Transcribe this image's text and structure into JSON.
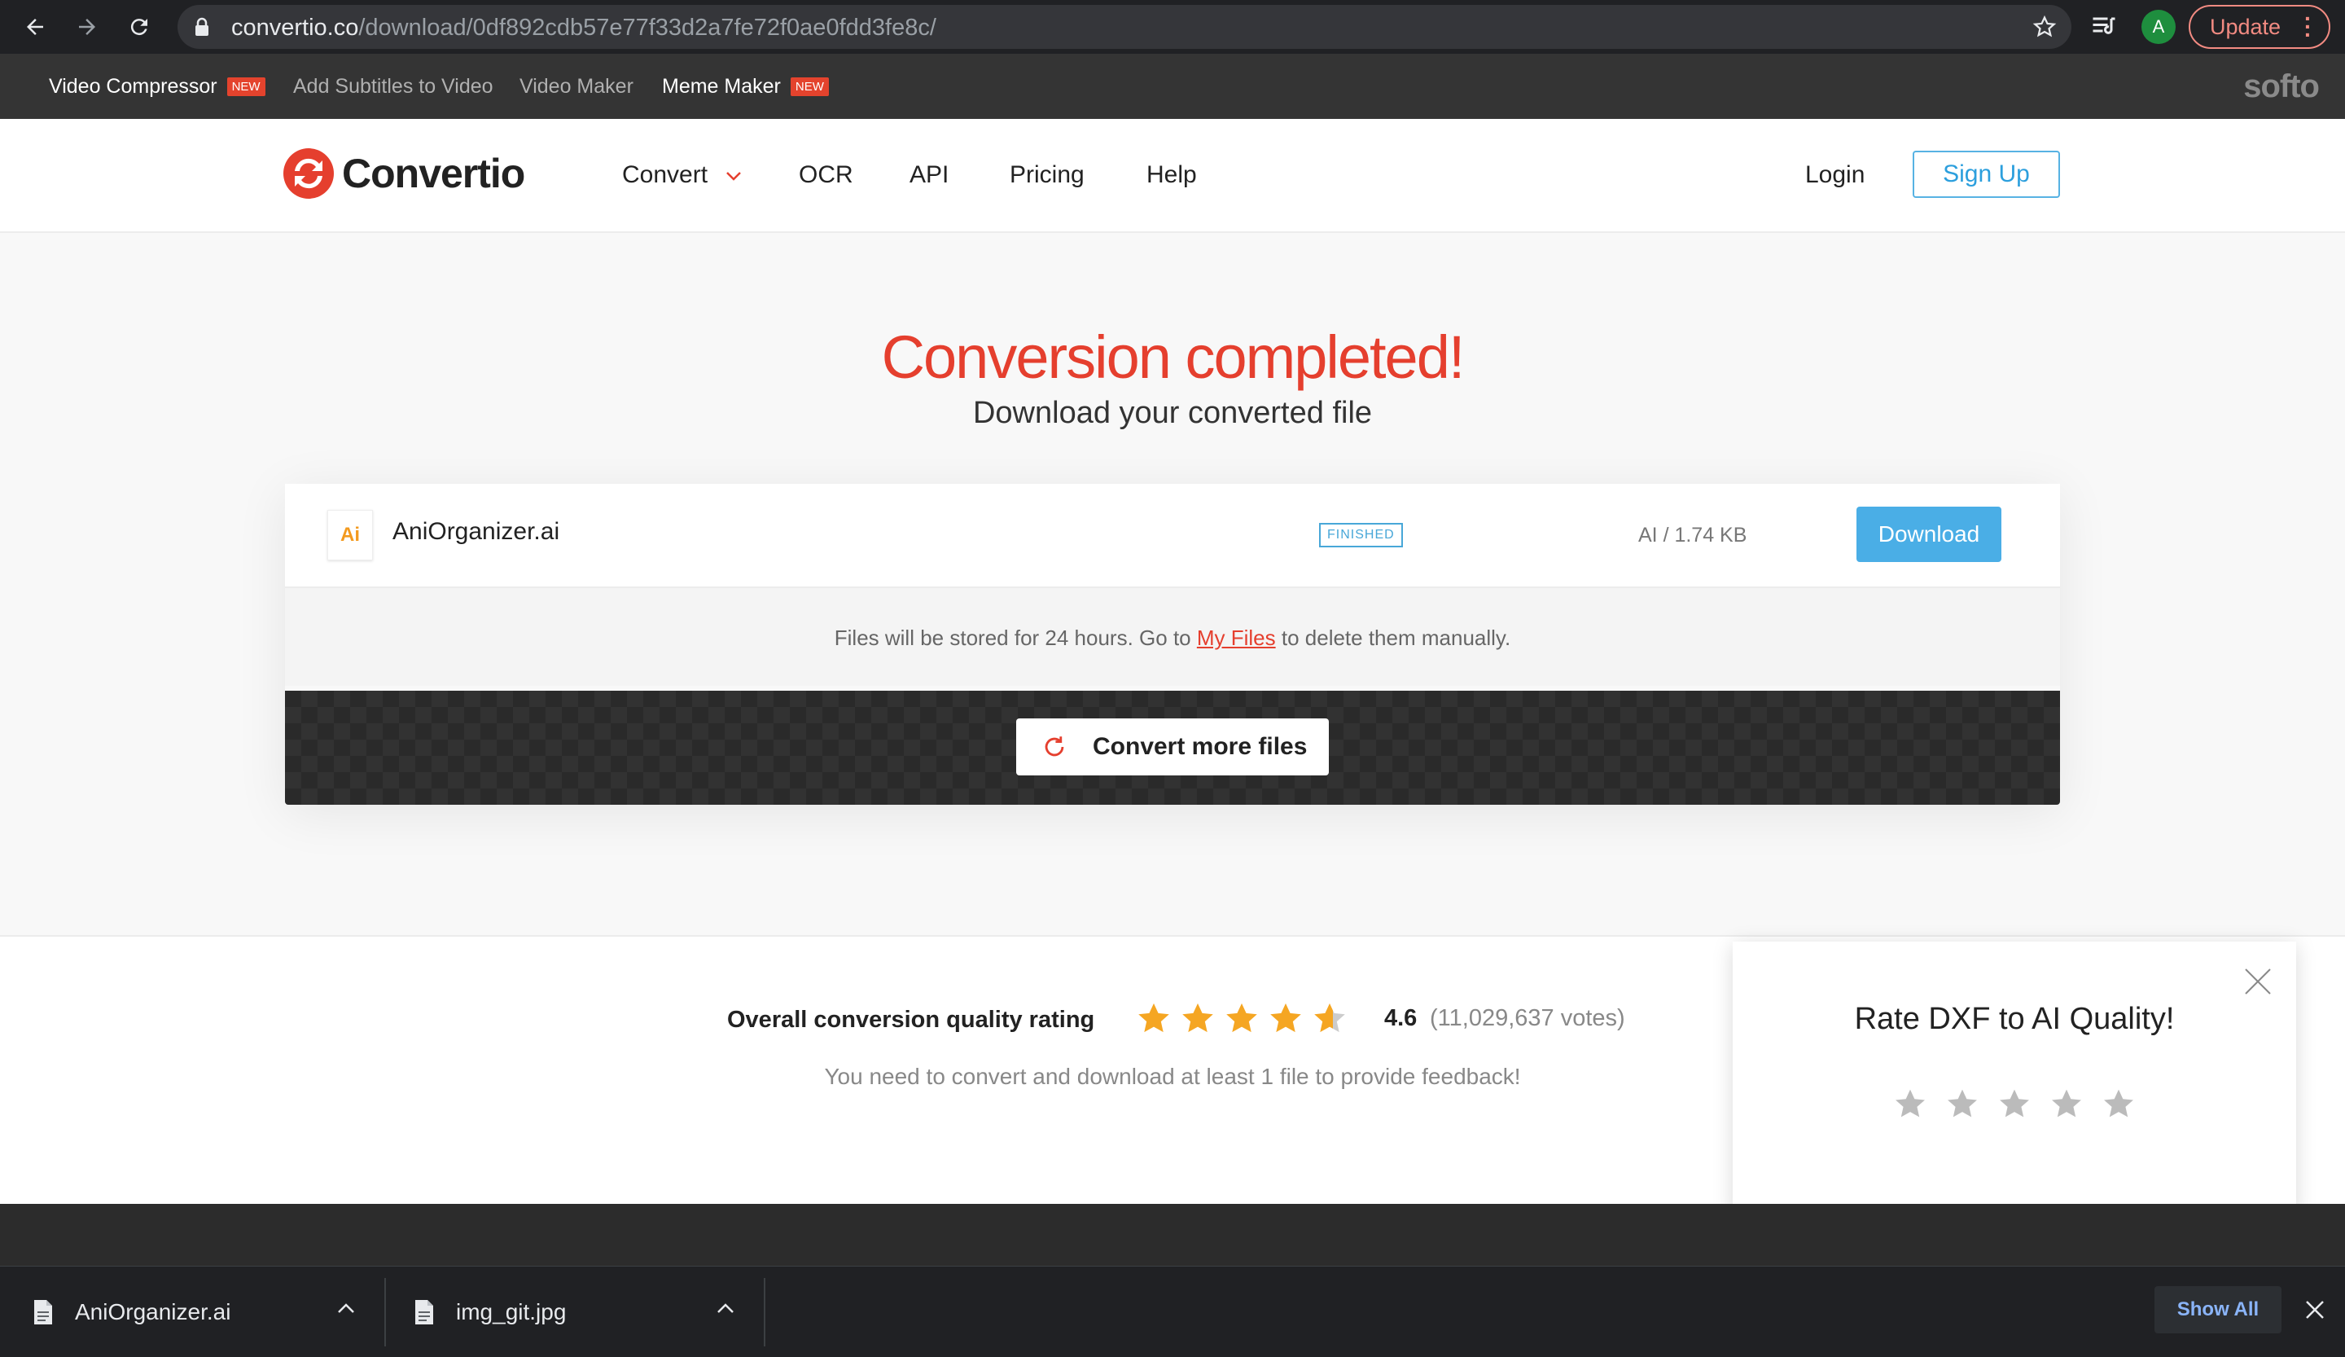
{
  "browser": {
    "url_host": "convertio.co",
    "url_path": "/download/0df892cdb57e77f33d2a7fe72f0ae0fdd3fe8c/",
    "profile_initial": "A",
    "update_label": "Update",
    "icons": [
      "back-icon",
      "forward-icon",
      "reload-icon",
      "lock-icon",
      "star-icon",
      "reading-list-icon",
      "more-icon"
    ]
  },
  "promo_bar": {
    "items": [
      {
        "label": "Video Compressor",
        "badge": "NEW"
      },
      {
        "label": "Add Subtitles to Video",
        "badge": ""
      },
      {
        "label": "Video Maker",
        "badge": ""
      },
      {
        "label": "Meme Maker",
        "badge": "NEW"
      }
    ],
    "brand": "softo"
  },
  "header": {
    "logo_text": "Convertio",
    "nav": [
      "Convert",
      "OCR",
      "API",
      "Pricing",
      "Help"
    ],
    "login": "Login",
    "signup": "Sign Up"
  },
  "hero": {
    "title": "Conversion completed!",
    "subtitle": "Download your converted file"
  },
  "file": {
    "icon_text": "Ai",
    "name": "AniOrganizer.ai",
    "status": "FINISHED",
    "size": "AI / 1.74 KB",
    "download_label": "Download"
  },
  "storage_note": {
    "before": "Files will be stored for 24 hours. Go to ",
    "link": "My Files",
    "after": " to delete them manually."
  },
  "convert_more": "Convert more files",
  "rating": {
    "label": "Overall conversion quality rating",
    "score": "4.6",
    "votes": "(11,029,637 votes)",
    "stars_value": 4.6,
    "note": "You need to convert and download at least 1 file to provide feedback!"
  },
  "rate_popup": {
    "title": "Rate DXF to AI Quality!",
    "stars": 5
  },
  "downloads": {
    "items": [
      "AniOrganizer.ai",
      "img_git.jpg"
    ],
    "show_all": "Show All"
  },
  "colors": {
    "accent_red": "#e53f2e",
    "accent_blue": "#4aaee6",
    "star_gold": "#f5a623"
  }
}
